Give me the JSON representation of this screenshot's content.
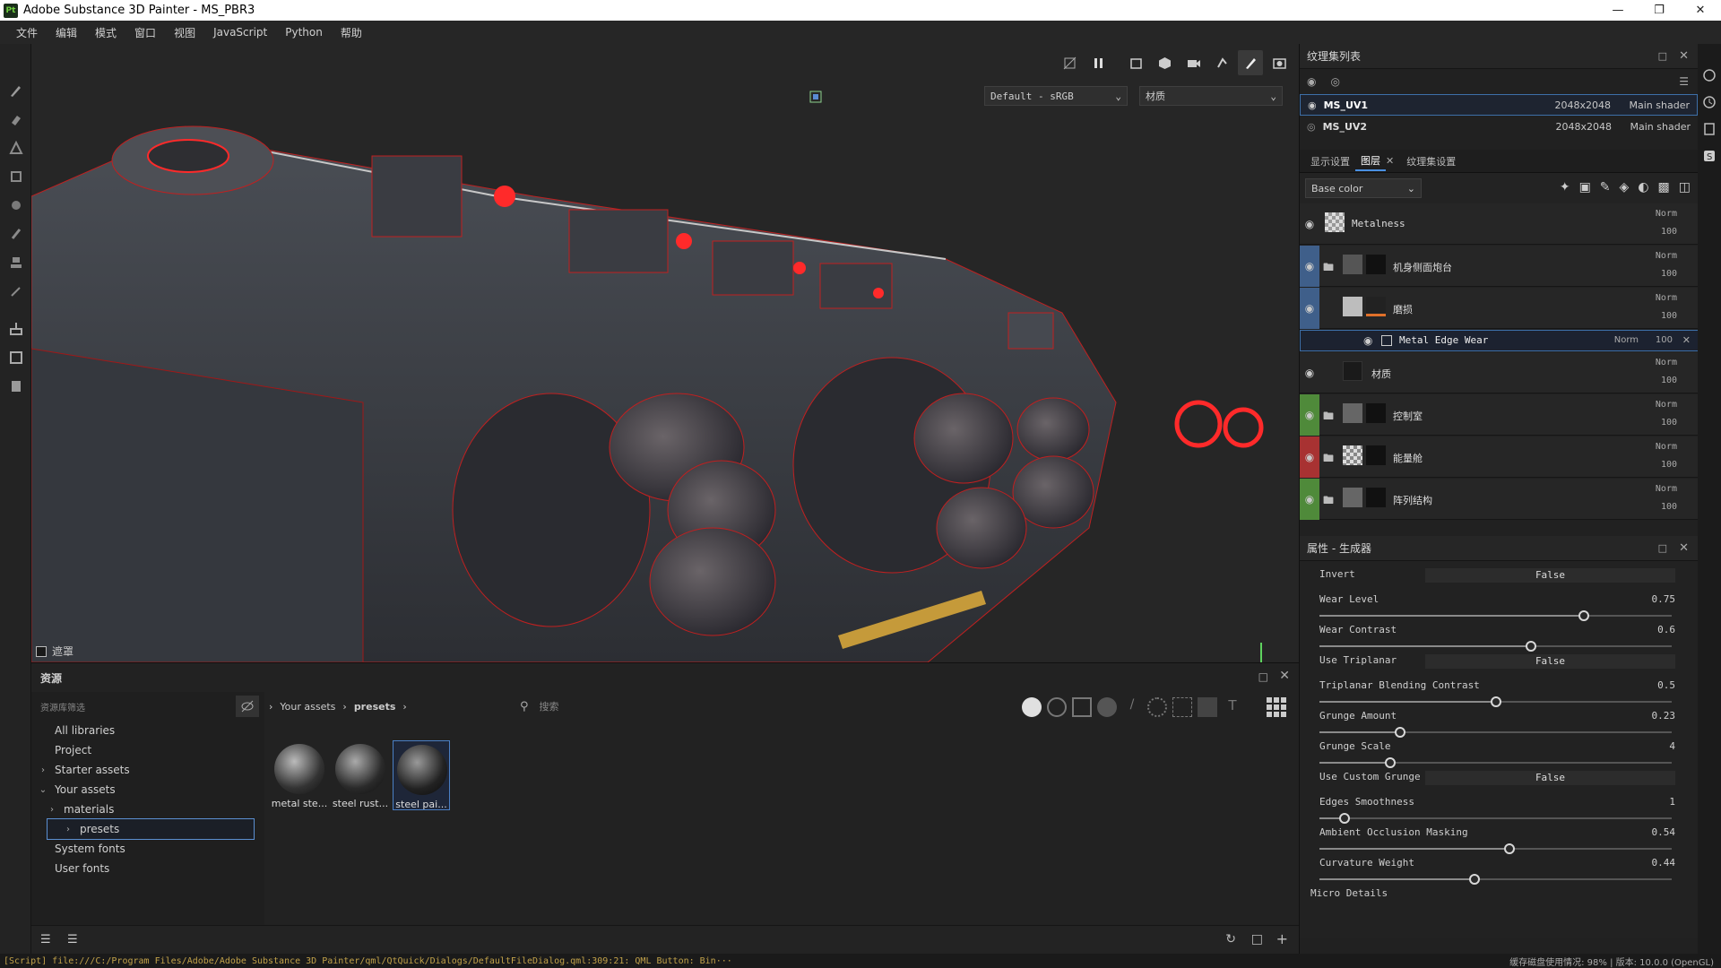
{
  "window": {
    "title": "Adobe Substance 3D Painter - MS_PBR3",
    "app_icon": "Pt"
  },
  "menu": [
    "文件",
    "编辑",
    "模式",
    "窗口",
    "视图",
    "JavaScript",
    "Python",
    "帮助"
  ],
  "viewport": {
    "colorspace": "Default - sRGB",
    "channel": "材质",
    "mask_label": "遮罩"
  },
  "assets": {
    "title": "资源",
    "filter_label": "资源库筛选",
    "breadcrumb": [
      "Your assets",
      "presets"
    ],
    "search_placeholder": "搜索",
    "tree": [
      {
        "label": "All libraries",
        "level": 0,
        "arrow": ""
      },
      {
        "label": "Project",
        "level": 0,
        "arrow": ""
      },
      {
        "label": "Starter assets",
        "level": 0,
        "arrow": "›"
      },
      {
        "label": "Your assets",
        "level": 0,
        "arrow": "⌄"
      },
      {
        "label": "materials",
        "level": 1,
        "arrow": "›"
      },
      {
        "label": "presets",
        "level": 1,
        "arrow": "›",
        "selected": true
      },
      {
        "label": "System fonts",
        "level": 0,
        "arrow": ""
      },
      {
        "label": "User fonts",
        "level": 0,
        "arrow": ""
      }
    ],
    "items": [
      "metal ste...",
      "steel rust...",
      "steel pai..."
    ]
  },
  "texture_sets": {
    "title": "纹理集列表",
    "rows": [
      {
        "name": "MS_UV1",
        "size": "2048x2048",
        "shader": "Main shader",
        "selected": true
      },
      {
        "name": "MS_UV2",
        "size": "2048x2048",
        "shader": "Main shader",
        "selected": false
      }
    ]
  },
  "layers": {
    "tabs": [
      "显示设置",
      "图层",
      "纹理集设置"
    ],
    "channel_dropdown": "Base color",
    "items": [
      {
        "name": "Metalness",
        "blend": "Norm",
        "opacity": "100",
        "color": ""
      },
      {
        "name": "机身侧面炮台",
        "blend": "Norm",
        "opacity": "100",
        "color": "#3f5f8a"
      },
      {
        "name": "磨损",
        "blend": "Norm",
        "opacity": "100",
        "color": "#3f5f8a"
      },
      {
        "name": "Metal Edge Wear",
        "blend": "Norm",
        "opacity": "100",
        "color": ""
      },
      {
        "name": "材质",
        "blend": "Norm",
        "opacity": "100",
        "color": ""
      },
      {
        "name": "控制室",
        "blend": "Norm",
        "opacity": "100",
        "color": "#4f8a3a"
      },
      {
        "name": "能量舱",
        "blend": "Norm",
        "opacity": "100",
        "color": "#a83232"
      },
      {
        "name": "阵列结构",
        "blend": "Norm",
        "opacity": "100",
        "color": "#4f8a3a"
      }
    ]
  },
  "properties": {
    "title": "属性 - 生成器",
    "params": [
      {
        "label": "Invert",
        "type": "bool",
        "value": "False"
      },
      {
        "label": "Wear Level",
        "type": "slider",
        "value": "0.75",
        "fraction": 0.75
      },
      {
        "label": "Wear Contrast",
        "type": "slider",
        "value": "0.6",
        "fraction": 0.6
      },
      {
        "label": "Use Triplanar",
        "type": "bool",
        "value": "False"
      },
      {
        "label": "Triplanar Blending Contrast",
        "type": "slider",
        "value": "0.5",
        "fraction": 0.5
      },
      {
        "label": "Grunge Amount",
        "type": "slider",
        "value": "0.23",
        "fraction": 0.23
      },
      {
        "label": "Grunge Scale",
        "type": "slider",
        "value": "4",
        "fraction": 0.2
      },
      {
        "label": "Use Custom Grunge",
        "type": "bool",
        "value": "False"
      },
      {
        "label": "Edges Smoothness",
        "type": "slider",
        "value": "1",
        "fraction": 0.07
      },
      {
        "label": "Ambient Occlusion Masking",
        "type": "slider",
        "value": "0.54",
        "fraction": 0.54
      },
      {
        "label": "Curvature Weight",
        "type": "slider",
        "value": "0.44",
        "fraction": 0.44
      }
    ],
    "footer_section": "Micro Details"
  },
  "status": {
    "message": "[Script] file:///C:/Program Files/Adobe/Adobe Substance 3D Painter/qml/QtQuick/Dialogs/DefaultFileDialog.qml:309:21: QML Button: Bin···",
    "right": "缓存磁盘使用情况:   98%  |  版本: 10.0.0 (OpenGL)"
  },
  "colors": {
    "accent": "#4a90e2",
    "selection": "#3d6fa8",
    "wire": "#e02020"
  }
}
